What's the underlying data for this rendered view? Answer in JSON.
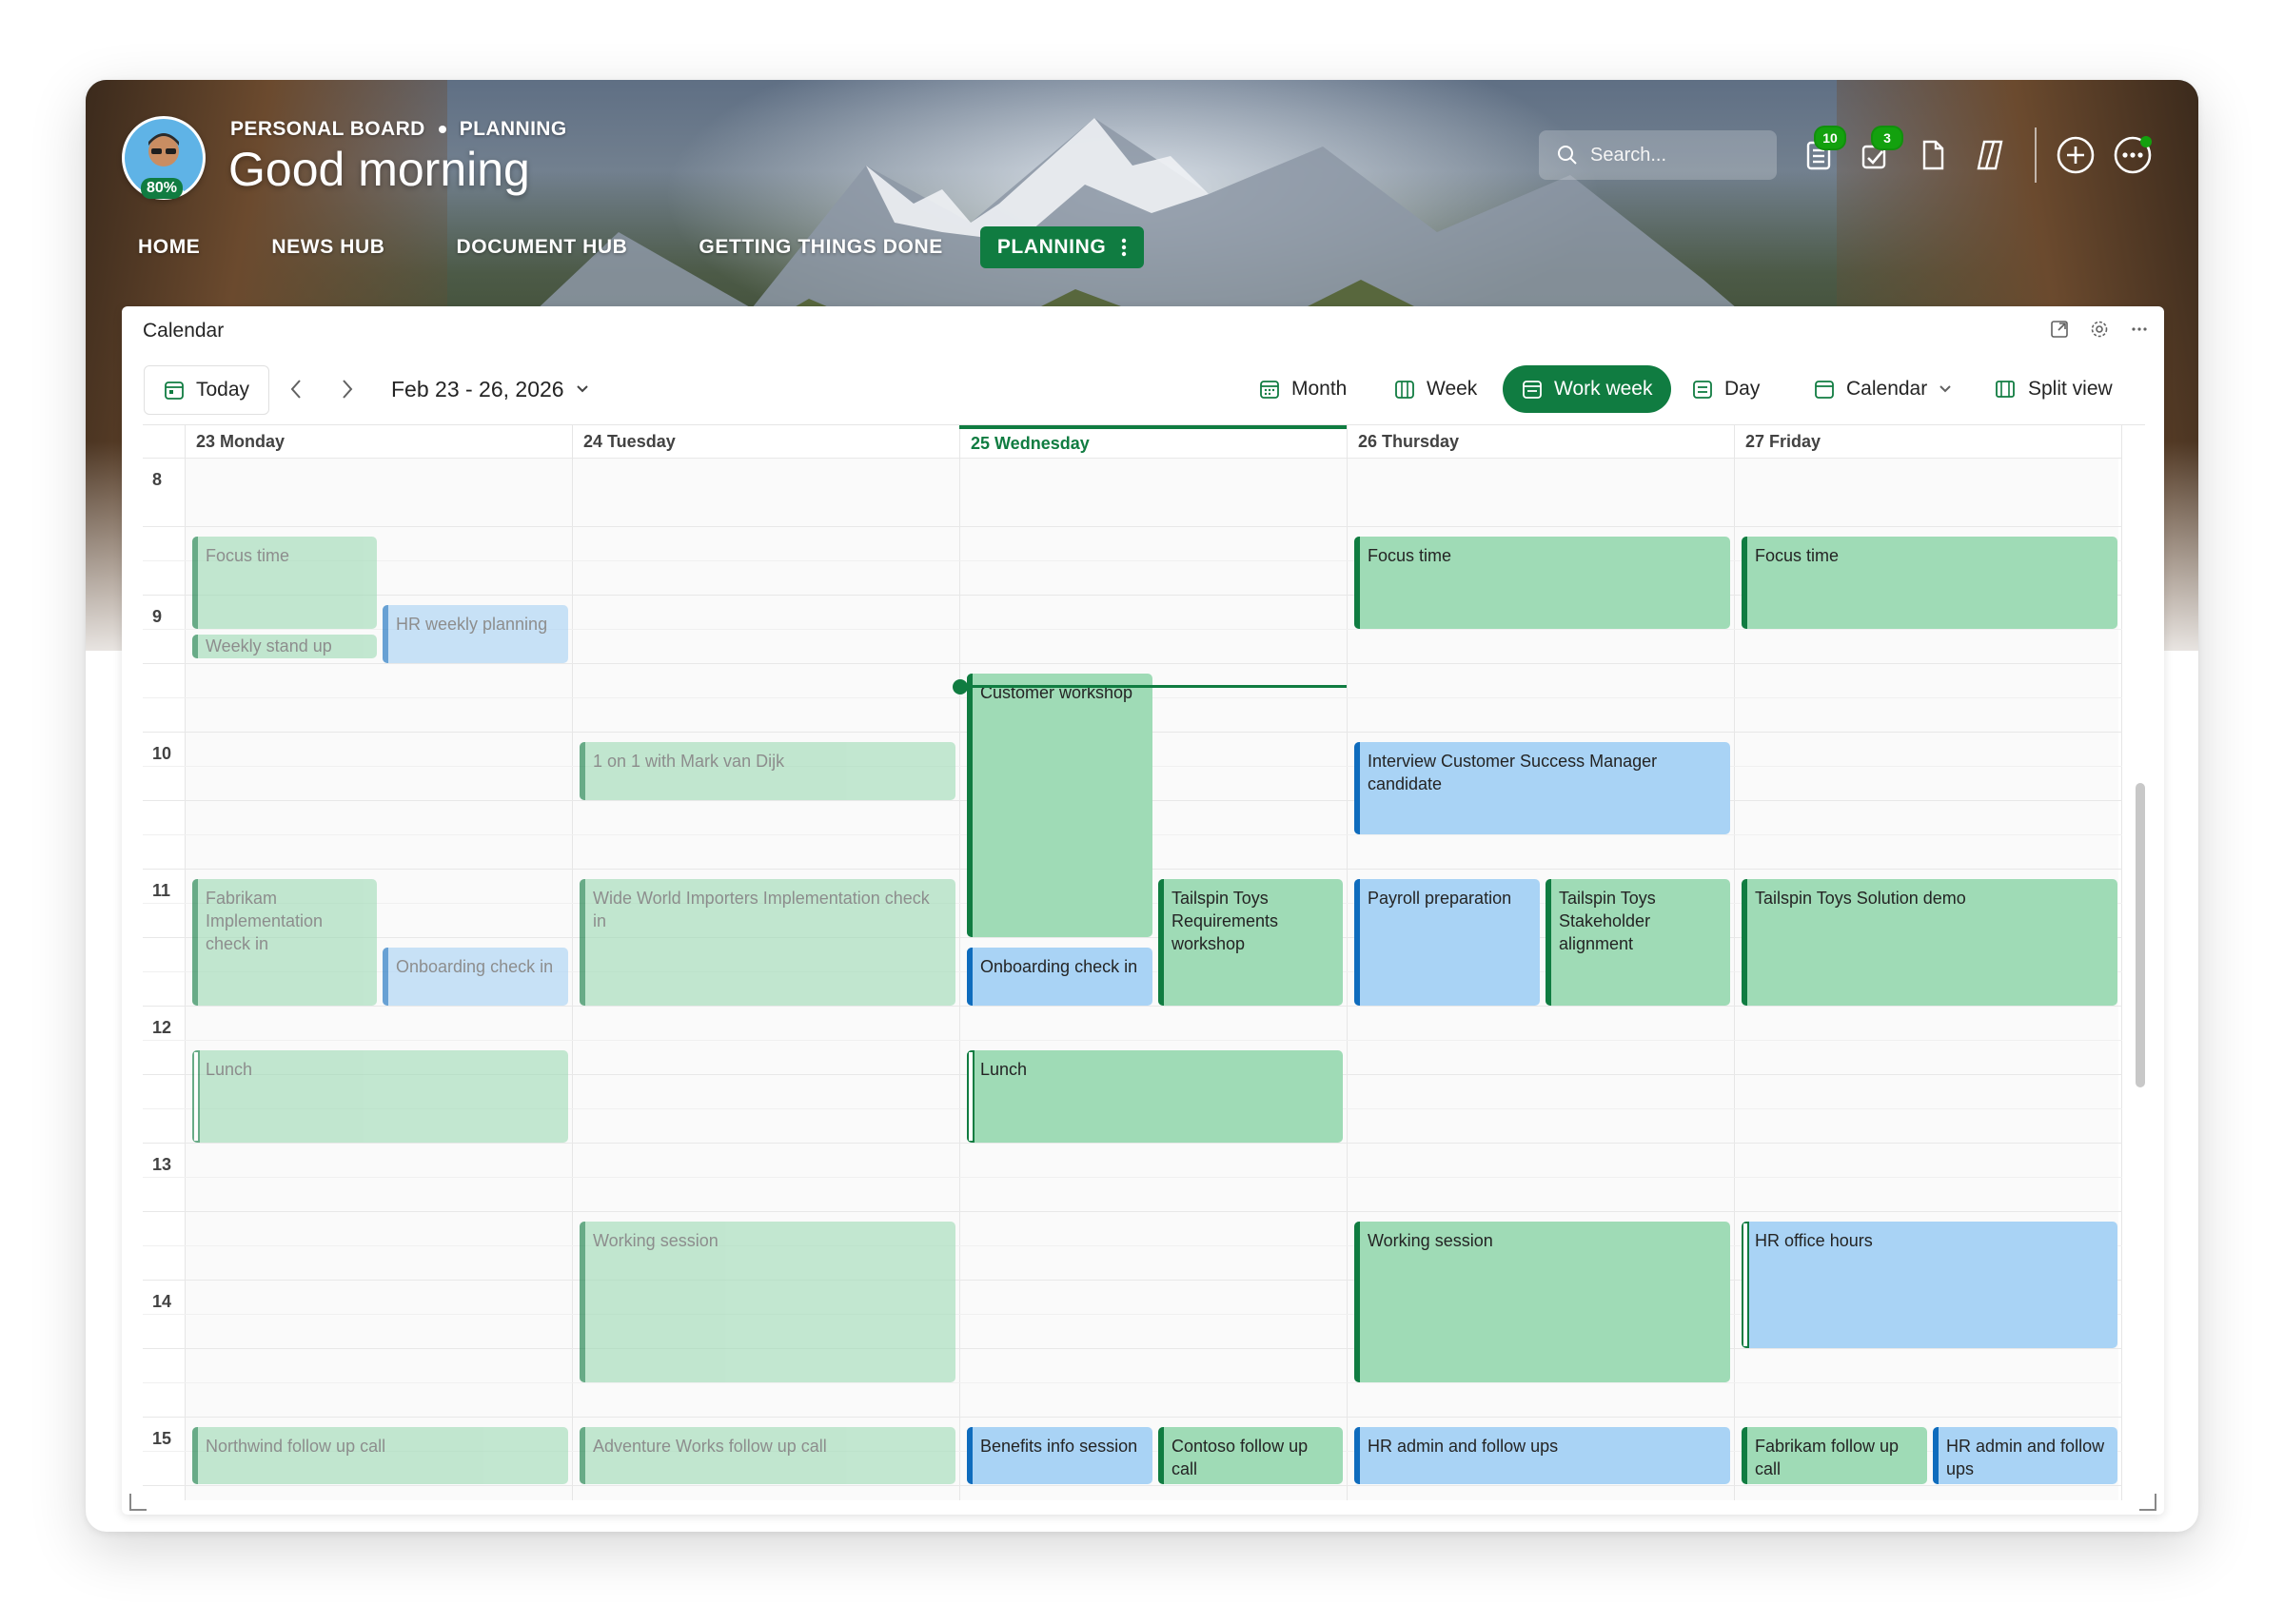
{
  "header": {
    "breadcrumb": [
      "PERSONAL BOARD",
      "PLANNING"
    ],
    "greeting": "Good morning",
    "avatar_badge": "80%",
    "search_placeholder": "Search...",
    "badges": {
      "tasks": "10",
      "approvals": "3"
    },
    "accent": "#107c41"
  },
  "nav": {
    "items": [
      "HOME",
      "NEWS HUB",
      "DOCUMENT HUB",
      "GETTING THINGS DONE"
    ],
    "active": "PLANNING"
  },
  "calendar": {
    "title": "Calendar",
    "today_label": "Today",
    "range_label": "Feb 23 - 26, 2026",
    "views": {
      "month": "Month",
      "week": "Week",
      "work_week": "Work week",
      "day": "Day",
      "calendar": "Calendar",
      "split": "Split view"
    },
    "active_view": "Work week",
    "days": [
      "23 Monday",
      "24 Tuesday",
      "25 Wednesday",
      "26 Thursday",
      "27 Friday"
    ],
    "today_index": 2,
    "hours": [
      "8",
      "9",
      "10",
      "11",
      "12",
      "13",
      "14",
      "15"
    ],
    "events": [
      {
        "title": "Focus time",
        "day": 0
      },
      {
        "title": "HR weekly planning",
        "day": 0
      },
      {
        "title": "Weekly stand up",
        "day": 0
      },
      {
        "title": "Fabrikam Implementation check in",
        "day": 0
      },
      {
        "title": "Onboarding check in",
        "day": 0
      },
      {
        "title": "Lunch",
        "day": 0
      },
      {
        "title": "Northwind follow up call",
        "day": 0
      },
      {
        "title": "1 on 1 with Mark van Dijk",
        "day": 1
      },
      {
        "title": "Wide World Importers Implementation check in",
        "day": 1
      },
      {
        "title": "Working session",
        "day": 1
      },
      {
        "title": "Adventure Works follow up call",
        "day": 1
      },
      {
        "title": "Customer workshop",
        "day": 2
      },
      {
        "title": "Tailspin Toys Requirements workshop",
        "day": 2
      },
      {
        "title": "Onboarding check in",
        "day": 2
      },
      {
        "title": "Lunch",
        "day": 2
      },
      {
        "title": "Benefits info session",
        "day": 2
      },
      {
        "title": "Contoso follow up call",
        "day": 2
      },
      {
        "title": "Focus time",
        "day": 3
      },
      {
        "title": "Interview Customer Success Manager candidate",
        "day": 3
      },
      {
        "title": "Payroll preparation",
        "day": 3
      },
      {
        "title": "Tailspin Toys Stakeholder alignment",
        "day": 3
      },
      {
        "title": "Working session",
        "day": 3
      },
      {
        "title": "HR admin and follow ups",
        "day": 3
      },
      {
        "title": "Focus time",
        "day": 4
      },
      {
        "title": "Tailspin Toys Solution demo",
        "day": 4
      },
      {
        "title": "HR office hours",
        "day": 4
      },
      {
        "title": "Fabrikam follow up call",
        "day": 4
      },
      {
        "title": "HR admin and follow ups",
        "day": 4
      }
    ]
  }
}
